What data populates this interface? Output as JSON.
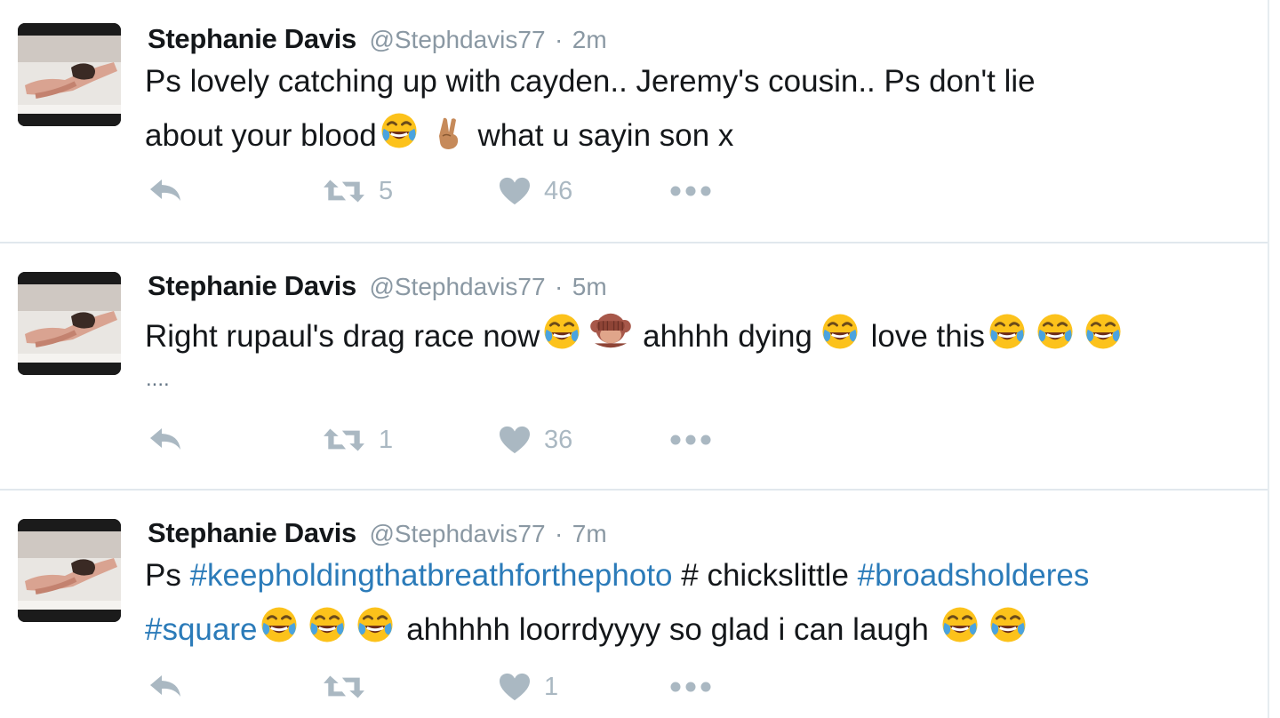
{
  "tweets": [
    {
      "name": "Stephanie Davis",
      "handle": "@Stephdavis77",
      "separator": "·",
      "time": "2m",
      "line1": "Ps lovely catching up with cayden.. Jeremy's cousin.. Ps don't lie",
      "line2a": "about your blood",
      "line2b": " what u sayin son x",
      "retweets": "5",
      "likes": "46"
    },
    {
      "name": "Stephanie Davis",
      "handle": "@Stephdavis77",
      "separator": "·",
      "time": "5m",
      "line1a": "Right rupaul's drag race now",
      "line1b": " ahhhh dying",
      "line1c": " love this",
      "line2": "....",
      "retweets": "1",
      "likes": "36"
    },
    {
      "name": "Stephanie Davis",
      "handle": "@Stephdavis77",
      "separator": "·",
      "time": "7m",
      "line1_prefix": "Ps ",
      "line1_tag1": "#keepholdingthatbreathforthephoto",
      "line1_mid": " # chickslittle ",
      "line1_tag2": "#broadsholderes",
      "line2_tag": "#square",
      "line2_text": " ahhhhh loorrdyyyy so glad i can laugh ",
      "retweets": "",
      "likes": "1"
    }
  ],
  "icons": {
    "reply": "reply-icon",
    "retweet": "retweet-icon",
    "like": "heart-icon",
    "more": "more-icon",
    "emoji_laugh": "tears-of-joy-emoji",
    "emoji_peace": "victory-hand-emoji",
    "emoji_monkey": "see-no-evil-monkey-emoji"
  },
  "colors": {
    "name": "#14171a",
    "meta": "#8a98a3",
    "action": "#aab8c2",
    "hashtag": "#2b7bb9",
    "separator": "#e1e8ed"
  }
}
